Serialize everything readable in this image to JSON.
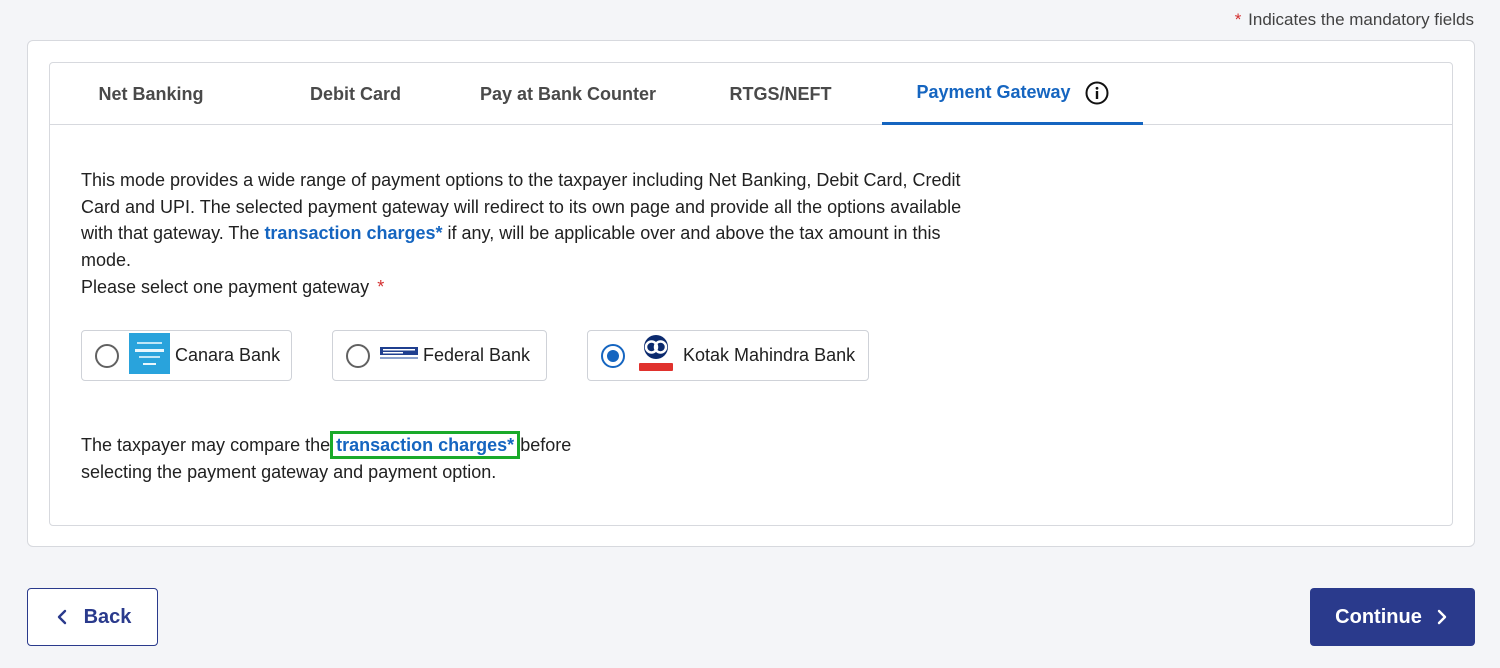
{
  "header": {
    "mandatory_star": "*",
    "mandatory_note": "Indicates the mandatory fields"
  },
  "tabs": [
    {
      "label": "Net Banking"
    },
    {
      "label": "Debit Card"
    },
    {
      "label": "Pay at Bank Counter"
    },
    {
      "label": "RTGS/NEFT"
    },
    {
      "label": "Payment Gateway",
      "active": true
    }
  ],
  "content": {
    "desc_part1": "This mode provides a wide range of payment options to the taxpayer including Net Banking, Debit Card, Credit Card and UPI. The selected payment gateway will redirect to its own page and provide all the options available with that gateway. The ",
    "desc_link": "transaction charges*",
    "desc_part2": " if any, will be applicable over and above the tax amount in this mode.",
    "select_prompt": "Please select one payment gateway",
    "select_star": "*"
  },
  "gateways": [
    {
      "name": "Canara Bank",
      "selected": false
    },
    {
      "name": "Federal Bank",
      "selected": false
    },
    {
      "name": "Kotak Mahindra Bank",
      "selected": true
    }
  ],
  "footer_note": {
    "part1": "The taxpayer may compare the",
    "link": "transaction charges*",
    "part2": "before selecting the payment gateway and payment option."
  },
  "buttons": {
    "back": "Back",
    "continue": "Continue"
  },
  "colors": {
    "accent": "#1565c0",
    "primary_button": "#2a3a8c",
    "required": "#d32f2f",
    "highlight": "#1aaa2a"
  }
}
